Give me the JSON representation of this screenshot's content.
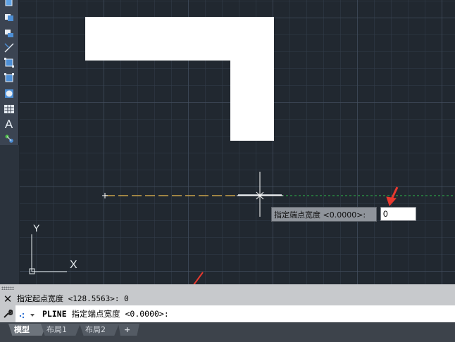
{
  "toolbar": {
    "tools": [
      "copy-icon",
      "region-icon",
      "mirror-icon",
      "line-icon",
      "rect-select-icon",
      "boundary-icon",
      "circle-icon",
      "table-icon",
      "text-icon",
      "point-icon"
    ],
    "text_glyph": "A"
  },
  "drawing": {
    "ucs_y_label": "Y",
    "ucs_x_label": "X"
  },
  "dynamic_input": {
    "prompt": "指定端点宽度 <0.0000>:",
    "value": "0"
  },
  "command_history": {
    "line": "指定起点宽度 <128.5563>: 0"
  },
  "command_line": {
    "keyword": "PLINE",
    "prompt": " 指定端点宽度 <0.0000>:"
  },
  "layout_tabs": [
    {
      "label": "模型",
      "active": true
    },
    {
      "label": "布局1",
      "active": false
    },
    {
      "label": "布局2",
      "active": false
    }
  ],
  "add_tab_label": "+",
  "colors": {
    "canvas": "#212830",
    "annotation_arrow": "#e8392f",
    "polyline_preview": "#c9a24a",
    "tracking_line": "#2db84a"
  }
}
